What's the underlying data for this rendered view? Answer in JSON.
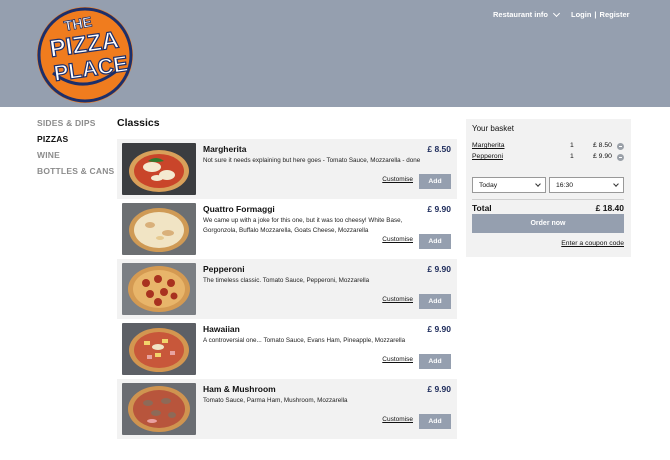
{
  "header": {
    "logo_text": [
      "THE",
      "PIZZA",
      "PLACE"
    ],
    "restaurant_info": "Restaurant info",
    "login": "Login",
    "separator": "|",
    "register": "Register"
  },
  "categories": [
    {
      "label": "SIDES & DIPS",
      "active": false
    },
    {
      "label": "PIZZAS",
      "active": true
    },
    {
      "label": "WINE",
      "active": false
    },
    {
      "label": "BOTTLES & CANS",
      "active": false
    }
  ],
  "section_title": "Classics",
  "products": [
    {
      "name": "Margherita",
      "price": "£ 8.50",
      "desc": "Not sure it needs explaining but here goes - Tomato Sauce, Mozzarella - done",
      "customise": "Customise",
      "add": "Add"
    },
    {
      "name": "Quattro Formaggi",
      "price": "£ 9.90",
      "desc": "We came up with a joke for this one, but it was too cheesy! White Base, Gorgonzola, Buffalo Mozzarella, Goats Cheese, Mozzarella",
      "customise": "Customise",
      "add": "Add"
    },
    {
      "name": "Pepperoni",
      "price": "£ 9.90",
      "desc": "The timeless classic. Tomato Sauce, Pepperoni, Mozzarella",
      "customise": "Customise",
      "add": "Add"
    },
    {
      "name": "Hawaiian",
      "price": "£ 9.90",
      "desc": "A controversial one... Tomato Sauce, Evans Ham, Pineapple, Mozzarella",
      "customise": "Customise",
      "add": "Add"
    },
    {
      "name": "Ham & Mushroom",
      "price": "£ 9.90",
      "desc": "Tomato Sauce, Parma Ham, Mushroom, Mozzarella",
      "customise": "Customise",
      "add": "Add"
    }
  ],
  "basket": {
    "title": "Your basket",
    "items": [
      {
        "name": "Margherita",
        "qty": "1",
        "price": "£ 8.50"
      },
      {
        "name": "Pepperoni",
        "qty": "1",
        "price": "£ 9.90"
      }
    ],
    "day": "Today",
    "time": "16:30",
    "total_label": "Total",
    "total_value": "£ 18.40",
    "order_button": "Order now",
    "coupon_link": "Enter a coupon code"
  },
  "colors": {
    "header_bg": "#959faf",
    "logo_orange": "#f07c1e",
    "logo_navy": "#1c2f6b",
    "panel_bg": "#f2f2f2",
    "button_bg": "#959faf"
  }
}
